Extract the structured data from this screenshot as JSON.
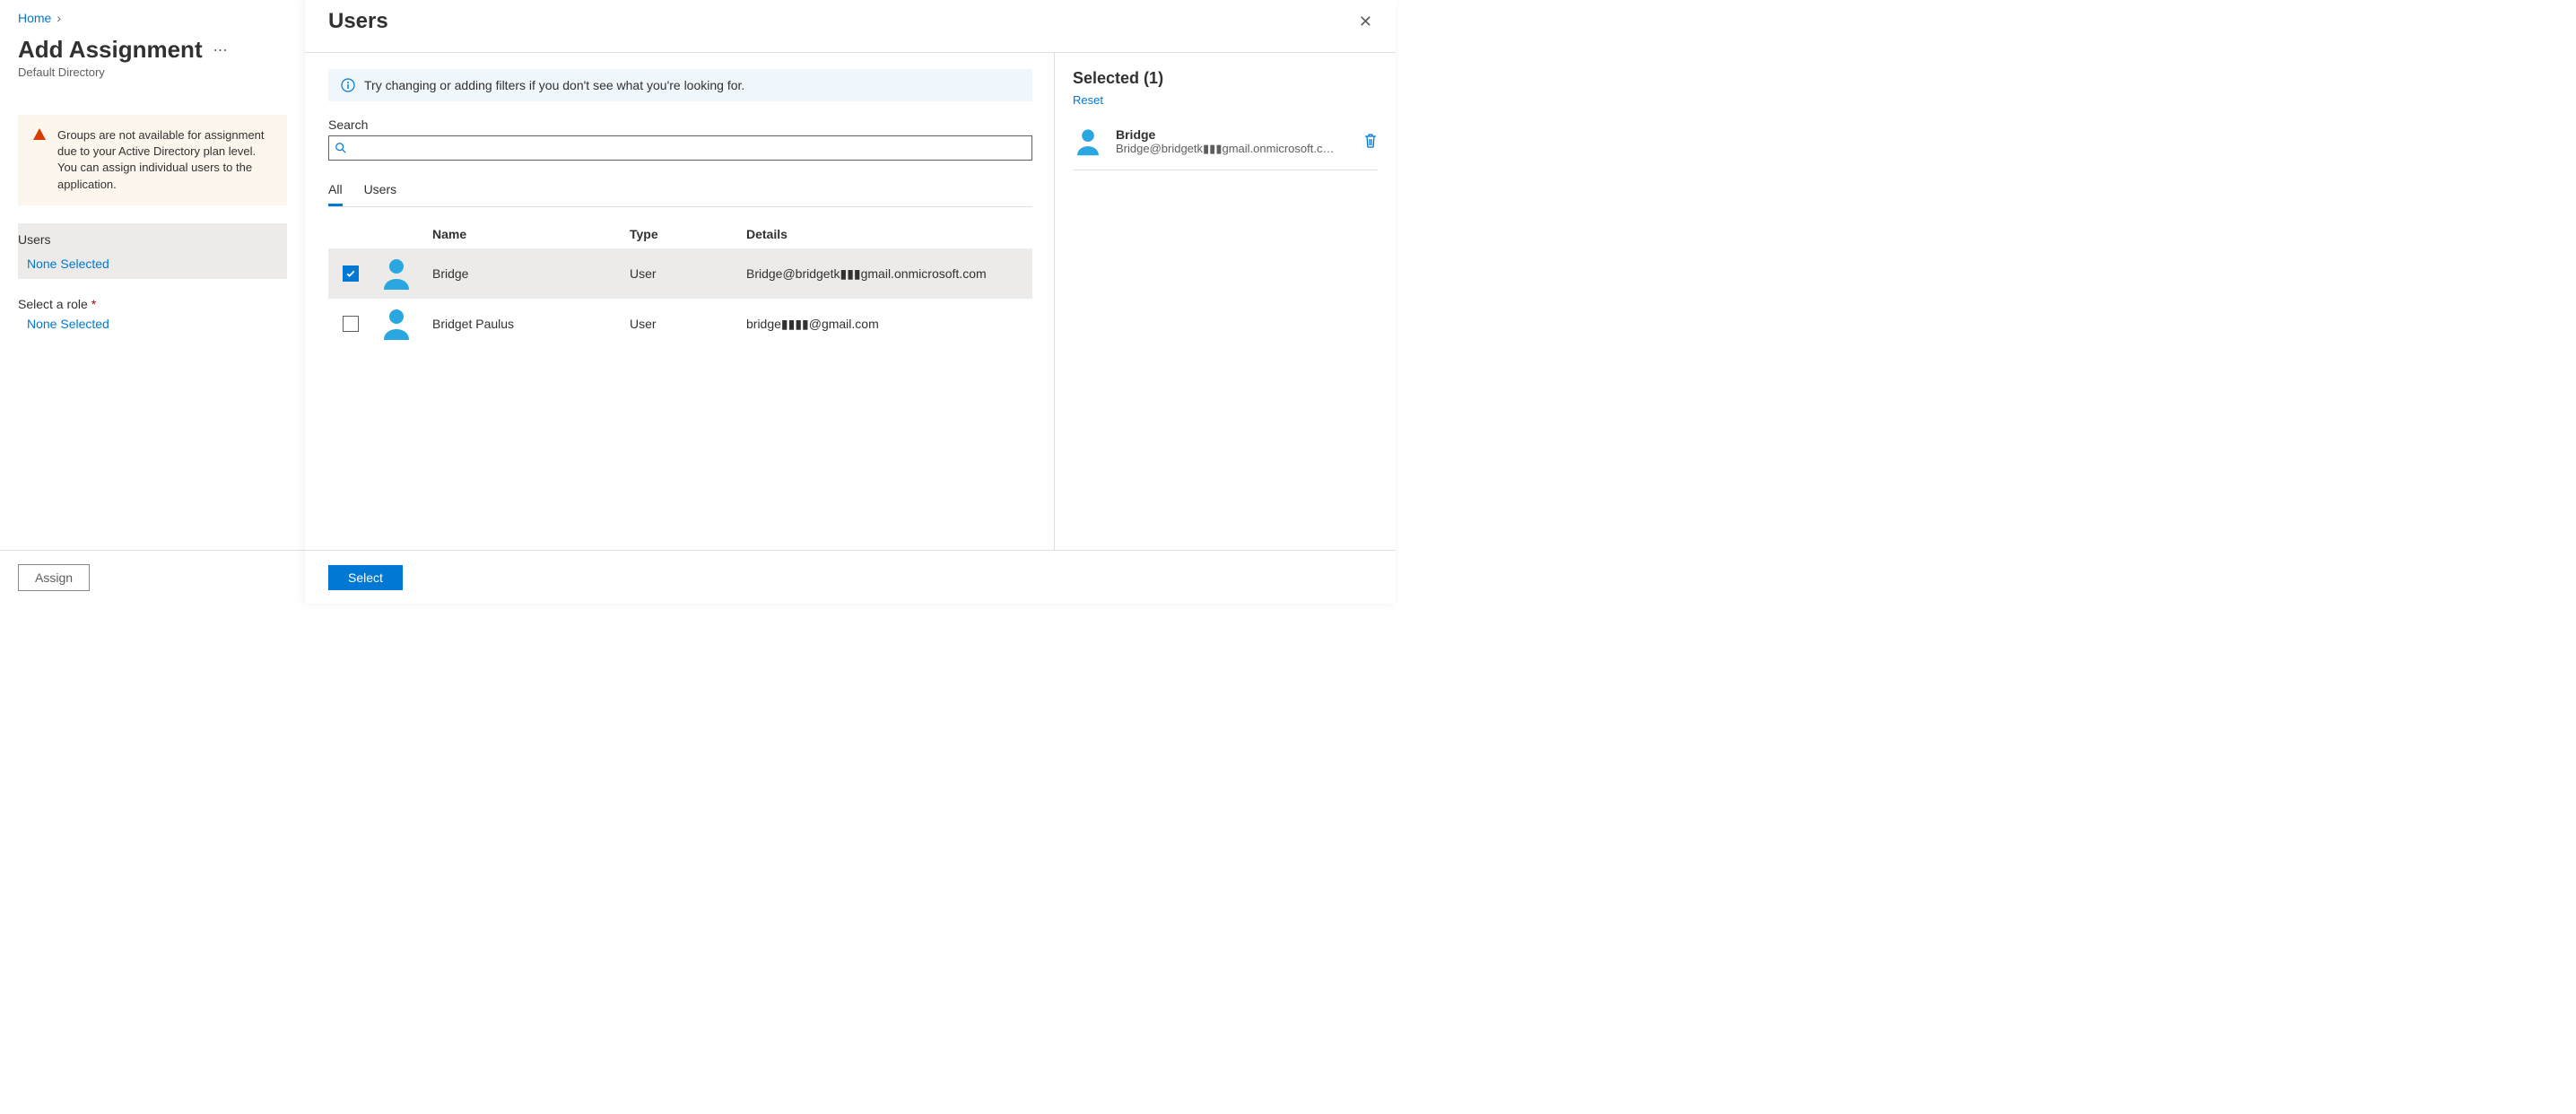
{
  "breadcrumb": {
    "home": "Home"
  },
  "page": {
    "title": "Add Assignment",
    "subtitle": "Default Directory"
  },
  "alert": {
    "text": "Groups are not available for assignment due to your Active Directory plan level. You can assign individual users to the application."
  },
  "left": {
    "users_label": "Users",
    "users_value": "None Selected",
    "role_label": "Select a role",
    "role_value": "None Selected",
    "assign_label": "Assign"
  },
  "panel": {
    "title": "Users",
    "info": "Try changing or adding filters if you don't see what you're looking for.",
    "search_label": "Search",
    "search_value": "",
    "tabs": {
      "all": "All",
      "users": "Users"
    },
    "columns": {
      "name": "Name",
      "type": "Type",
      "details": "Details"
    },
    "rows": [
      {
        "checked": true,
        "name": "Bridge",
        "type": "User",
        "details": "Bridge@bridgetk▮▮▮gmail.onmicrosoft.com"
      },
      {
        "checked": false,
        "name": "Bridget Paulus",
        "type": "User",
        "details": "bridge▮▮▮▮@gmail.com"
      }
    ],
    "selected": {
      "heading_prefix": "Selected (",
      "count": "1",
      "heading_suffix": ")",
      "reset": "Reset",
      "items": [
        {
          "name": "Bridge",
          "email": "Bridge@bridgetk▮▮▮gmail.onmicrosoft.c…"
        }
      ]
    },
    "select_button": "Select"
  }
}
